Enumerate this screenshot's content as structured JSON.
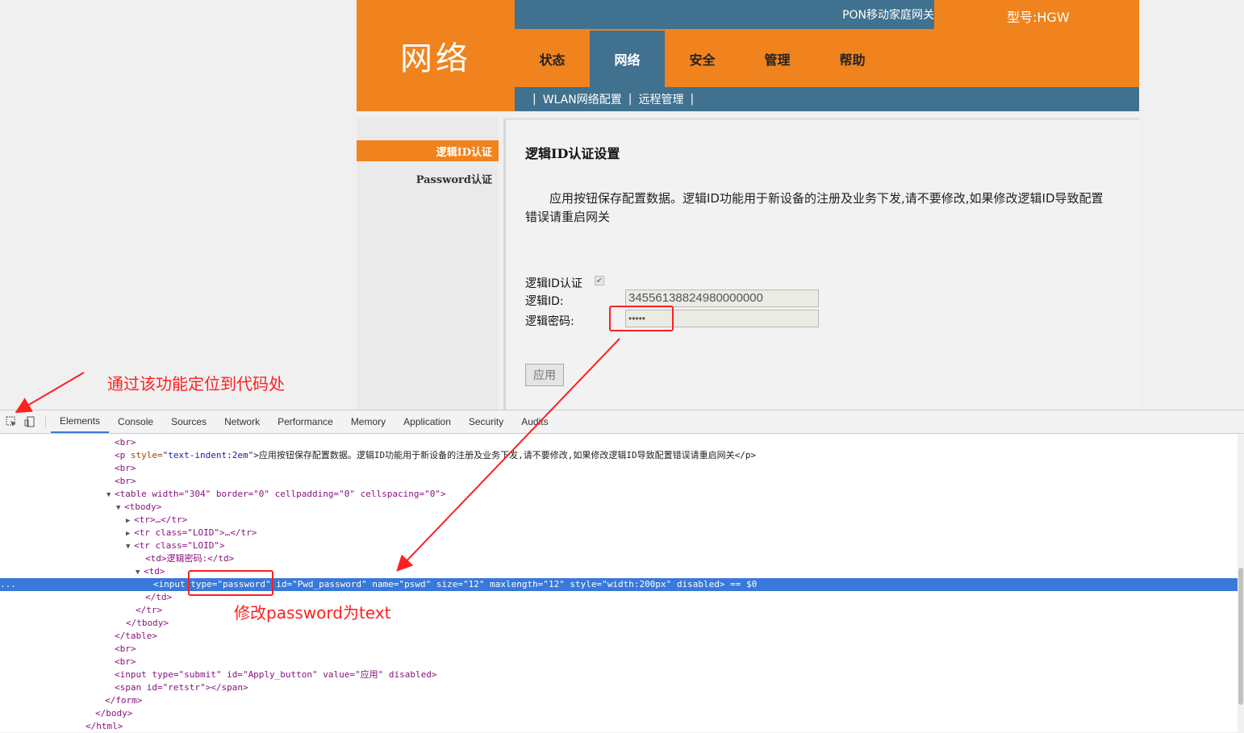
{
  "router": {
    "logo_text": "网络",
    "title": "PON移动家庭网关",
    "model": "型号:HGW",
    "nav": [
      "状态",
      "网络",
      "安全",
      "管理",
      "帮助"
    ],
    "subnav": [
      "WLAN网络配置",
      "远程管理"
    ],
    "sidebar": [
      "逻辑ID认证",
      "Password认证"
    ],
    "content_title": "逻辑ID认证设置",
    "description": "应用按钮保存配置数据。逻辑ID功能用于新设备的注册及业务下发,请不要修改,如果修改逻辑ID导致配置错误请重启网关",
    "form": {
      "auth_label": "逻辑ID认证",
      "id_label": "逻辑ID:",
      "id_value": "34556138824980000000",
      "password_label": "逻辑密码:",
      "password_value": "•••••"
    },
    "apply_label": "应用",
    "colors": {
      "orange": "#f0831d",
      "blue": "#40718f"
    }
  },
  "devtools": {
    "tabs": [
      "Elements",
      "Console",
      "Sources",
      "Network",
      "Performance",
      "Memory",
      "Application",
      "Security",
      "Audits"
    ],
    "dom_lines": {
      "l0": "<br>",
      "l1_tag_open": "<p ",
      "l1_attr": "style=",
      "l1_val": "\"text-indent:2em\"",
      "l1_text": ">应用按钮保存配置数据。逻辑ID功能用于新设备的注册及业务下发,请不要修改,如果修改逻辑ID导致配置错误请重启网关</p>",
      "l2": "<br>",
      "l3": "<br>",
      "l4": "<table width=\"304\" border=\"0\" cellpadding=\"0\" cellspacing=\"0\">",
      "l5": "<tbody>",
      "l6": "<tr>…</tr>",
      "l7": "<tr class=\"LOID\">…</tr>",
      "l8": "<tr class=\"LOID\">",
      "l9": "<td>逻辑密码:</td>",
      "l10": "<td>",
      "l11": "<input type=\"password\" id=\"Pwd_password\" name=\"pswd\" size=\"12\" maxlength=\"12\" style=\"width:200px\" disabled> == $0",
      "l12": "</td>",
      "l13": "</tr>",
      "l14": "</tbody>",
      "l15": "</table>",
      "l16": "<br>",
      "l17": "<br>",
      "l18": "<input type=\"submit\" id=\"Apply_button\" value=\"应用\" disabled>",
      "l19": "<span id=\"retstr\"></span>",
      "l20": "</form>",
      "l21": "</body>",
      "l22": "</html>",
      "ellipsis": "..."
    }
  },
  "annotations": {
    "locate_hint": "通过该功能定位到代码处",
    "modify_hint": "修改password为text"
  }
}
